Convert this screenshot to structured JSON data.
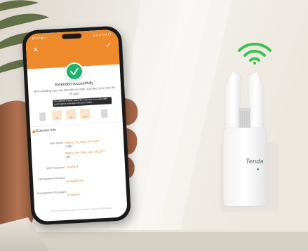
{
  "phone": {
    "status_time": "10:29 ◉ ···",
    "status_icons": "⊿.ıl ⊿.ıl ≋ 〇",
    "close_glyph": "✕",
    "confirm_glyph": "✓",
    "success_title": "Extended successfully",
    "success_desc": "Wi-Fi sharing may not start till seconds. Connect to a new Wi-Fi later.",
    "tip_text": "For optimal results, place the extender in an area with good signal coverage from your router.",
    "zone_labels": [
      "OK",
      "OK",
      "Best"
    ],
    "section_title": "Extender Info",
    "wifi_name_label": "WiFi Name",
    "wifi_name_24": "MBGiu_Pro_Beta_Test_EXT",
    "band_24": "2.4G",
    "wifi_name_5": "MBGiu_Pro_Beta_Test_5G_EXT",
    "band_5": "5G",
    "wifi_password_label": "WiFi Password",
    "wifi_password": "12345678",
    "mgmt_address_label": "Management Address",
    "mgmt_address": "tendawifi.com",
    "mgmt_password_label": "Management Password",
    "mgmt_password": "12345678",
    "footnote": "* It is recommended to take a screenshot to save Wi-Fi information."
  },
  "extender": {
    "brand": "Tenda"
  },
  "colors": {
    "accent_orange": "#ee8a2c",
    "success_green": "#1eb46a",
    "wifi_green": "#3cc24f"
  },
  "icons": {
    "wifi": "wifi-icon",
    "success": "checkmark-circle-icon",
    "close": "close-icon",
    "confirm": "check-icon"
  }
}
